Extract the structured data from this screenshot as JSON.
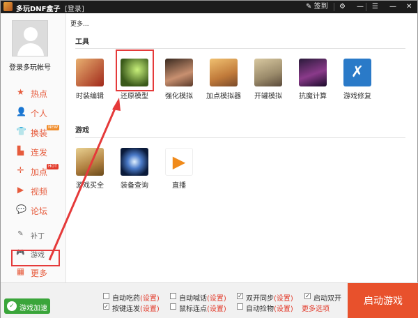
{
  "titlebar": {
    "app_title": "多玩DNF盒子",
    "login_link": "[登录]",
    "signin_label": "签到",
    "settings_glyph": "⚙",
    "minimize_glyph": "—",
    "menu_glyph": "☰",
    "close_glyph": "✕"
  },
  "sidebar": {
    "account_label": "登录多玩帐号",
    "items": [
      {
        "label": "热点",
        "icon": "star-icon",
        "glyph": "★"
      },
      {
        "label": "个人",
        "icon": "person-icon",
        "glyph": "👤"
      },
      {
        "label": "换装",
        "icon": "shirt-icon",
        "glyph": "👕",
        "badge": "NEW"
      },
      {
        "label": "连发",
        "icon": "blocks-icon",
        "glyph": "▙"
      },
      {
        "label": "加点",
        "icon": "crosshair-icon",
        "glyph": "✛",
        "badge": "HOT"
      },
      {
        "label": "视频",
        "icon": "video-icon",
        "glyph": "▶"
      },
      {
        "label": "论坛",
        "icon": "chat-icon",
        "glyph": "💬"
      },
      {
        "label": "补丁",
        "icon": "patch-icon",
        "glyph": "✎"
      },
      {
        "label": "游戏",
        "icon": "gamepad-icon",
        "glyph": "🎮"
      },
      {
        "label": "更多",
        "icon": "grid-icon",
        "glyph": "▦"
      }
    ]
  },
  "main": {
    "breadcrumb": "更多...",
    "tools_title": "工具",
    "games_title": "游戏",
    "tools": [
      {
        "label": "时装编辑",
        "color": "#b8402a"
      },
      {
        "label": "还原模型",
        "color": "#4a6a2c"
      },
      {
        "label": "强化模拟",
        "color": "#6b4a3a"
      },
      {
        "label": "加点模拟器",
        "color": "#c98a3a"
      },
      {
        "label": "开罐模拟",
        "color": "#8a7a5a"
      },
      {
        "label": "抗魔计算",
        "color": "#5a2a5a"
      },
      {
        "label": "游戏修复",
        "color": "#2a7ac8"
      }
    ],
    "games": [
      {
        "label": "游戏买全",
        "color": "#c8a050"
      },
      {
        "label": "装备查询",
        "color": "#1a2a4a"
      },
      {
        "label": "直播",
        "color": "#f08a1a"
      }
    ]
  },
  "bottombar": {
    "accel_label": "游戏加速",
    "options": [
      {
        "text": "自动吃药",
        "set": "(设置)",
        "checked": false
      },
      {
        "text": "自动喊话",
        "set": "(设置)",
        "checked": false
      },
      {
        "text": "双开同步",
        "set": "(设置)",
        "checked": true
      },
      {
        "text": "启动双开",
        "set": "",
        "checked": true
      },
      {
        "text": "按键连发",
        "set": "(设置)",
        "checked": true
      },
      {
        "text": "鼠标连点",
        "set": "(设置)",
        "checked": false
      },
      {
        "text": "自动捡物",
        "set": "(设置)",
        "checked": false
      }
    ],
    "more_options": "更多选项",
    "launch_label": "启动游戏"
  },
  "colors": {
    "accent": "#e65b3c",
    "launch": "#e8512c",
    "accel": "#3aa53a",
    "highlight": "#e53a3a"
  }
}
